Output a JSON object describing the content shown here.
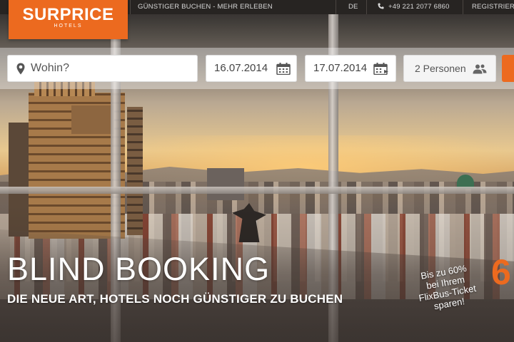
{
  "logo": {
    "brand": "SURPRICE",
    "sub": "HOTELS",
    "color": "#ec6a1f"
  },
  "nav": {
    "tagline": "GÜNSTIGER BUCHEN - MEHR ERLEBEN",
    "language": "DE",
    "phone": "+49 221 2077 6860",
    "register": "REGISTRIERI"
  },
  "search": {
    "destination_placeholder": "Wohin?",
    "checkin": "16.07.2014",
    "checkout": "17.07.2014",
    "guests": "2 Personen",
    "button_color": "#ec6a1f"
  },
  "hero": {
    "headline": "BLIND BOOKING",
    "subline": "DIE NEUE ART, HOTELS NOCH GÜNSTIGER ZU BUCHEN",
    "promo_lines": [
      "Bis zu 60%",
      "bei Ihrem",
      "FlixBus-Ticket",
      "sparen!"
    ],
    "promo_number": "6"
  },
  "icons": {
    "location": "map-pin-icon",
    "calendar": "calendar-icon",
    "guests": "people-icon",
    "phone": "phone-icon"
  }
}
